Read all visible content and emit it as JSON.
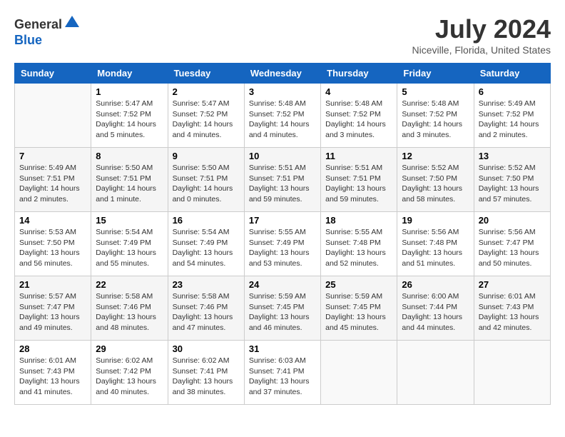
{
  "header": {
    "logo_line1": "General",
    "logo_line2": "Blue",
    "month_title": "July 2024",
    "location": "Niceville, Florida, United States"
  },
  "days_of_week": [
    "Sunday",
    "Monday",
    "Tuesday",
    "Wednesday",
    "Thursday",
    "Friday",
    "Saturday"
  ],
  "weeks": [
    [
      {
        "day": "",
        "info": ""
      },
      {
        "day": "1",
        "info": "Sunrise: 5:47 AM\nSunset: 7:52 PM\nDaylight: 14 hours\nand 5 minutes."
      },
      {
        "day": "2",
        "info": "Sunrise: 5:47 AM\nSunset: 7:52 PM\nDaylight: 14 hours\nand 4 minutes."
      },
      {
        "day": "3",
        "info": "Sunrise: 5:48 AM\nSunset: 7:52 PM\nDaylight: 14 hours\nand 4 minutes."
      },
      {
        "day": "4",
        "info": "Sunrise: 5:48 AM\nSunset: 7:52 PM\nDaylight: 14 hours\nand 3 minutes."
      },
      {
        "day": "5",
        "info": "Sunrise: 5:48 AM\nSunset: 7:52 PM\nDaylight: 14 hours\nand 3 minutes."
      },
      {
        "day": "6",
        "info": "Sunrise: 5:49 AM\nSunset: 7:52 PM\nDaylight: 14 hours\nand 2 minutes."
      }
    ],
    [
      {
        "day": "7",
        "info": "Sunrise: 5:49 AM\nSunset: 7:51 PM\nDaylight: 14 hours\nand 2 minutes."
      },
      {
        "day": "8",
        "info": "Sunrise: 5:50 AM\nSunset: 7:51 PM\nDaylight: 14 hours\nand 1 minute."
      },
      {
        "day": "9",
        "info": "Sunrise: 5:50 AM\nSunset: 7:51 PM\nDaylight: 14 hours\nand 0 minutes."
      },
      {
        "day": "10",
        "info": "Sunrise: 5:51 AM\nSunset: 7:51 PM\nDaylight: 13 hours\nand 59 minutes."
      },
      {
        "day": "11",
        "info": "Sunrise: 5:51 AM\nSunset: 7:51 PM\nDaylight: 13 hours\nand 59 minutes."
      },
      {
        "day": "12",
        "info": "Sunrise: 5:52 AM\nSunset: 7:50 PM\nDaylight: 13 hours\nand 58 minutes."
      },
      {
        "day": "13",
        "info": "Sunrise: 5:52 AM\nSunset: 7:50 PM\nDaylight: 13 hours\nand 57 minutes."
      }
    ],
    [
      {
        "day": "14",
        "info": "Sunrise: 5:53 AM\nSunset: 7:50 PM\nDaylight: 13 hours\nand 56 minutes."
      },
      {
        "day": "15",
        "info": "Sunrise: 5:54 AM\nSunset: 7:49 PM\nDaylight: 13 hours\nand 55 minutes."
      },
      {
        "day": "16",
        "info": "Sunrise: 5:54 AM\nSunset: 7:49 PM\nDaylight: 13 hours\nand 54 minutes."
      },
      {
        "day": "17",
        "info": "Sunrise: 5:55 AM\nSunset: 7:49 PM\nDaylight: 13 hours\nand 53 minutes."
      },
      {
        "day": "18",
        "info": "Sunrise: 5:55 AM\nSunset: 7:48 PM\nDaylight: 13 hours\nand 52 minutes."
      },
      {
        "day": "19",
        "info": "Sunrise: 5:56 AM\nSunset: 7:48 PM\nDaylight: 13 hours\nand 51 minutes."
      },
      {
        "day": "20",
        "info": "Sunrise: 5:56 AM\nSunset: 7:47 PM\nDaylight: 13 hours\nand 50 minutes."
      }
    ],
    [
      {
        "day": "21",
        "info": "Sunrise: 5:57 AM\nSunset: 7:47 PM\nDaylight: 13 hours\nand 49 minutes."
      },
      {
        "day": "22",
        "info": "Sunrise: 5:58 AM\nSunset: 7:46 PM\nDaylight: 13 hours\nand 48 minutes."
      },
      {
        "day": "23",
        "info": "Sunrise: 5:58 AM\nSunset: 7:46 PM\nDaylight: 13 hours\nand 47 minutes."
      },
      {
        "day": "24",
        "info": "Sunrise: 5:59 AM\nSunset: 7:45 PM\nDaylight: 13 hours\nand 46 minutes."
      },
      {
        "day": "25",
        "info": "Sunrise: 5:59 AM\nSunset: 7:45 PM\nDaylight: 13 hours\nand 45 minutes."
      },
      {
        "day": "26",
        "info": "Sunrise: 6:00 AM\nSunset: 7:44 PM\nDaylight: 13 hours\nand 44 minutes."
      },
      {
        "day": "27",
        "info": "Sunrise: 6:01 AM\nSunset: 7:43 PM\nDaylight: 13 hours\nand 42 minutes."
      }
    ],
    [
      {
        "day": "28",
        "info": "Sunrise: 6:01 AM\nSunset: 7:43 PM\nDaylight: 13 hours\nand 41 minutes."
      },
      {
        "day": "29",
        "info": "Sunrise: 6:02 AM\nSunset: 7:42 PM\nDaylight: 13 hours\nand 40 minutes."
      },
      {
        "day": "30",
        "info": "Sunrise: 6:02 AM\nSunset: 7:41 PM\nDaylight: 13 hours\nand 38 minutes."
      },
      {
        "day": "31",
        "info": "Sunrise: 6:03 AM\nSunset: 7:41 PM\nDaylight: 13 hours\nand 37 minutes."
      },
      {
        "day": "",
        "info": ""
      },
      {
        "day": "",
        "info": ""
      },
      {
        "day": "",
        "info": ""
      }
    ]
  ]
}
